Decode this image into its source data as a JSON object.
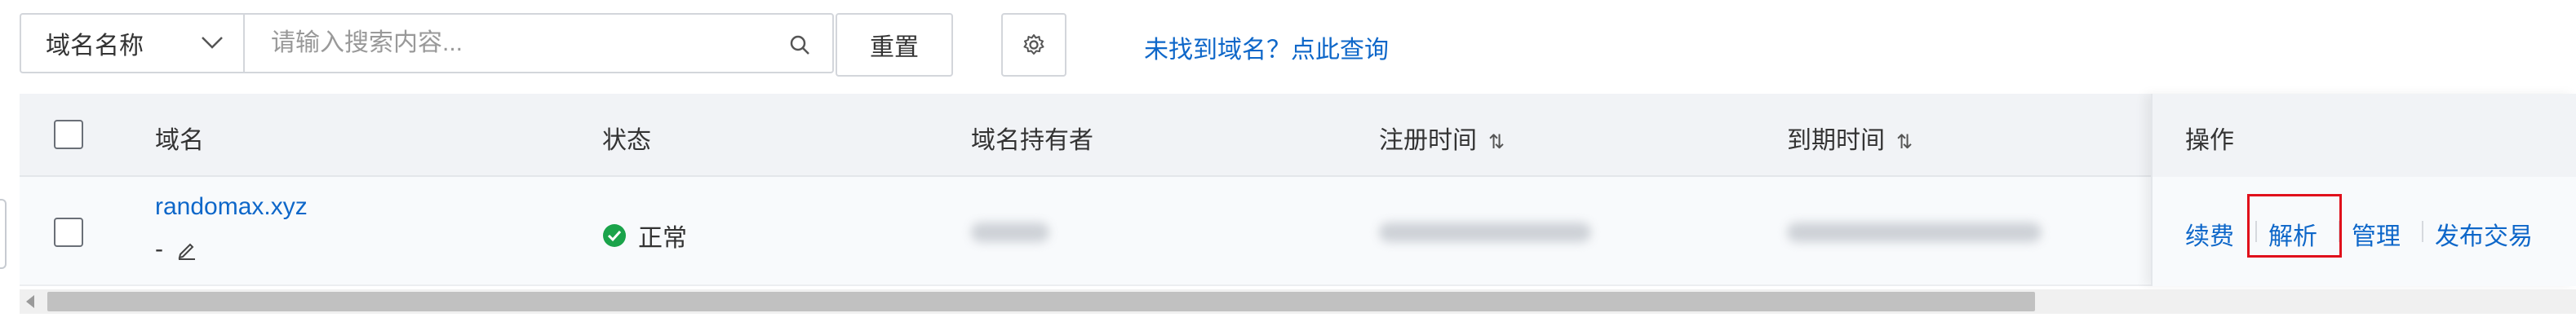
{
  "toolbar": {
    "search_type": "域名名称",
    "search_placeholder": "请输入搜索内容...",
    "reset_label": "重置",
    "find_link": "未找到域名？点此查询"
  },
  "table": {
    "columns": [
      "域名",
      "状态",
      "域名持有者",
      "注册时间",
      "到期时间",
      "操作"
    ],
    "sort_icon": "⇅",
    "rows": [
      {
        "domain": "randomax.xyz",
        "remark": "-",
        "status": "正常",
        "actions": [
          "续费",
          "解析",
          "管理",
          "发布交易"
        ]
      }
    ]
  },
  "colors": {
    "link": "#0e67c9",
    "status_ok": "#1aa34a",
    "highlight": "#e0101b"
  }
}
